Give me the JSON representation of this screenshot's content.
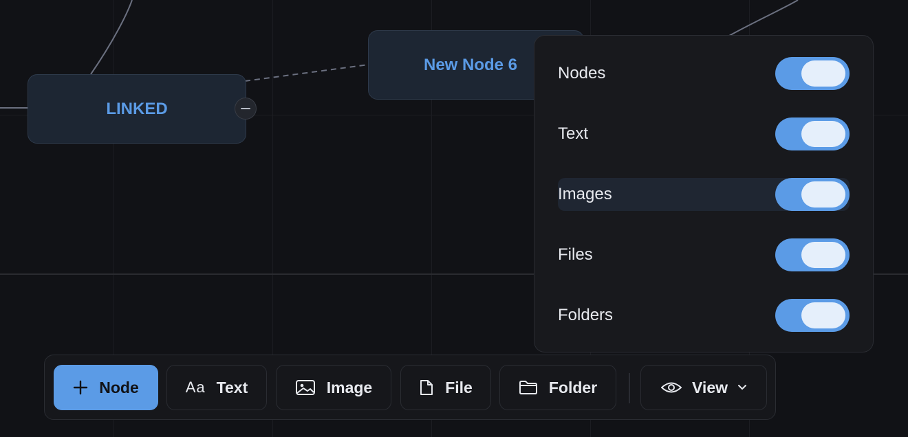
{
  "canvas": {
    "nodes": [
      {
        "label": "LINKED"
      },
      {
        "label": "New Node 6"
      }
    ]
  },
  "visibility_panel": {
    "items": [
      {
        "label": "Nodes",
        "enabled": true
      },
      {
        "label": "Text",
        "enabled": true
      },
      {
        "label": "Images",
        "enabled": true
      },
      {
        "label": "Files",
        "enabled": true
      },
      {
        "label": "Folders",
        "enabled": true
      }
    ]
  },
  "toolbar": {
    "node_label": "Node",
    "text_icon": "Aa",
    "text_label": "Text",
    "image_label": "Image",
    "file_label": "File",
    "folder_label": "Folder",
    "view_label": "View"
  },
  "icons": {
    "node": "plus-icon",
    "image": "image-icon",
    "file": "file-icon",
    "folder": "folder-icon",
    "view": "eye-icon",
    "dropdown": "chevron-down-icon",
    "collapse": "minus-icon"
  },
  "colors": {
    "accent": "#5b9be6",
    "background": "#111216",
    "node_fill": "#1d2633",
    "panel": "#18191d"
  }
}
